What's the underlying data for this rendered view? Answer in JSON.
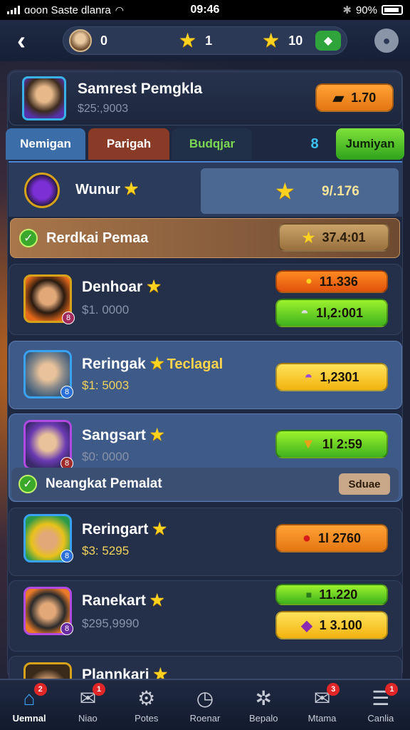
{
  "status_bar": {
    "carrier": "ɑoon Saste dlanra",
    "time": "09:46",
    "battery": "90%"
  },
  "top_bar": {
    "back_icon": "chevron-left-icon",
    "resources": [
      {
        "icon": "avatar",
        "value": "0"
      },
      {
        "icon": "star-icon",
        "value": "1"
      },
      {
        "icon": "star-icon",
        "value": "10"
      }
    ],
    "profile_icon": "user-icon"
  },
  "player": {
    "name": "Samrest Pemgkla",
    "subtitle": "$25:,9003",
    "reward": "1.70"
  },
  "tabs": [
    {
      "label": "Nemigan"
    },
    {
      "label": "Parigah"
    },
    {
      "label": "Budqjar"
    },
    {
      "label": "8"
    },
    {
      "label": "Jumiyan"
    }
  ],
  "hero": {
    "label": "Wunur",
    "value": "9/.176"
  },
  "banner": {
    "label": "Rerdkai Pemaa",
    "value": "37.4:01"
  },
  "rows": [
    {
      "name": "Denhoar",
      "tag": "",
      "subtitle": "$1. 0000",
      "badge": "8",
      "pills": [
        "11.336",
        "1l,2:001"
      ]
    },
    {
      "name": "Reringak",
      "tag": "Teclagal",
      "subtitle": "$1: 5003",
      "badge": "8",
      "pills": [
        "1,2301"
      ]
    },
    {
      "name": "Sangsart",
      "tag": "",
      "subtitle": "$0: 0000",
      "badge": "8",
      "pills": [
        "1l 2:59"
      ]
    },
    {
      "name": "Reringart",
      "tag": "",
      "subtitle": "$3: 5295",
      "badge": "8",
      "pills": [
        "1l 2760"
      ]
    },
    {
      "name": "Ranekart",
      "tag": "",
      "subtitle": "$295,9990",
      "badge": "8",
      "pills": [
        "11.220",
        "1 3.100"
      ]
    },
    {
      "name": "Plannkari",
      "tag": "",
      "subtitle": "",
      "badge": "",
      "pills": []
    }
  ],
  "sub_banner": {
    "label": "Neangkat Pemalat",
    "button": "Sduae"
  },
  "nav": [
    {
      "label": "Uemnal",
      "icon": "home-icon",
      "badge": "2"
    },
    {
      "label": "Niao",
      "icon": "mail-icon",
      "badge": "1"
    },
    {
      "label": "Potes",
      "icon": "gear-icon",
      "badge": ""
    },
    {
      "label": "Roenar",
      "icon": "clock-icon",
      "badge": ""
    },
    {
      "label": "Bepalo",
      "icon": "cog-icon",
      "badge": ""
    },
    {
      "label": "Mtama",
      "icon": "check-mail-icon",
      "badge": "3"
    },
    {
      "label": "Canlia",
      "icon": "list-icon",
      "badge": "1"
    }
  ],
  "colors": {
    "accent": "#3aa2f2",
    "gold": "#ffd21f",
    "green": "#3fb11d",
    "orange": "#e47612"
  }
}
